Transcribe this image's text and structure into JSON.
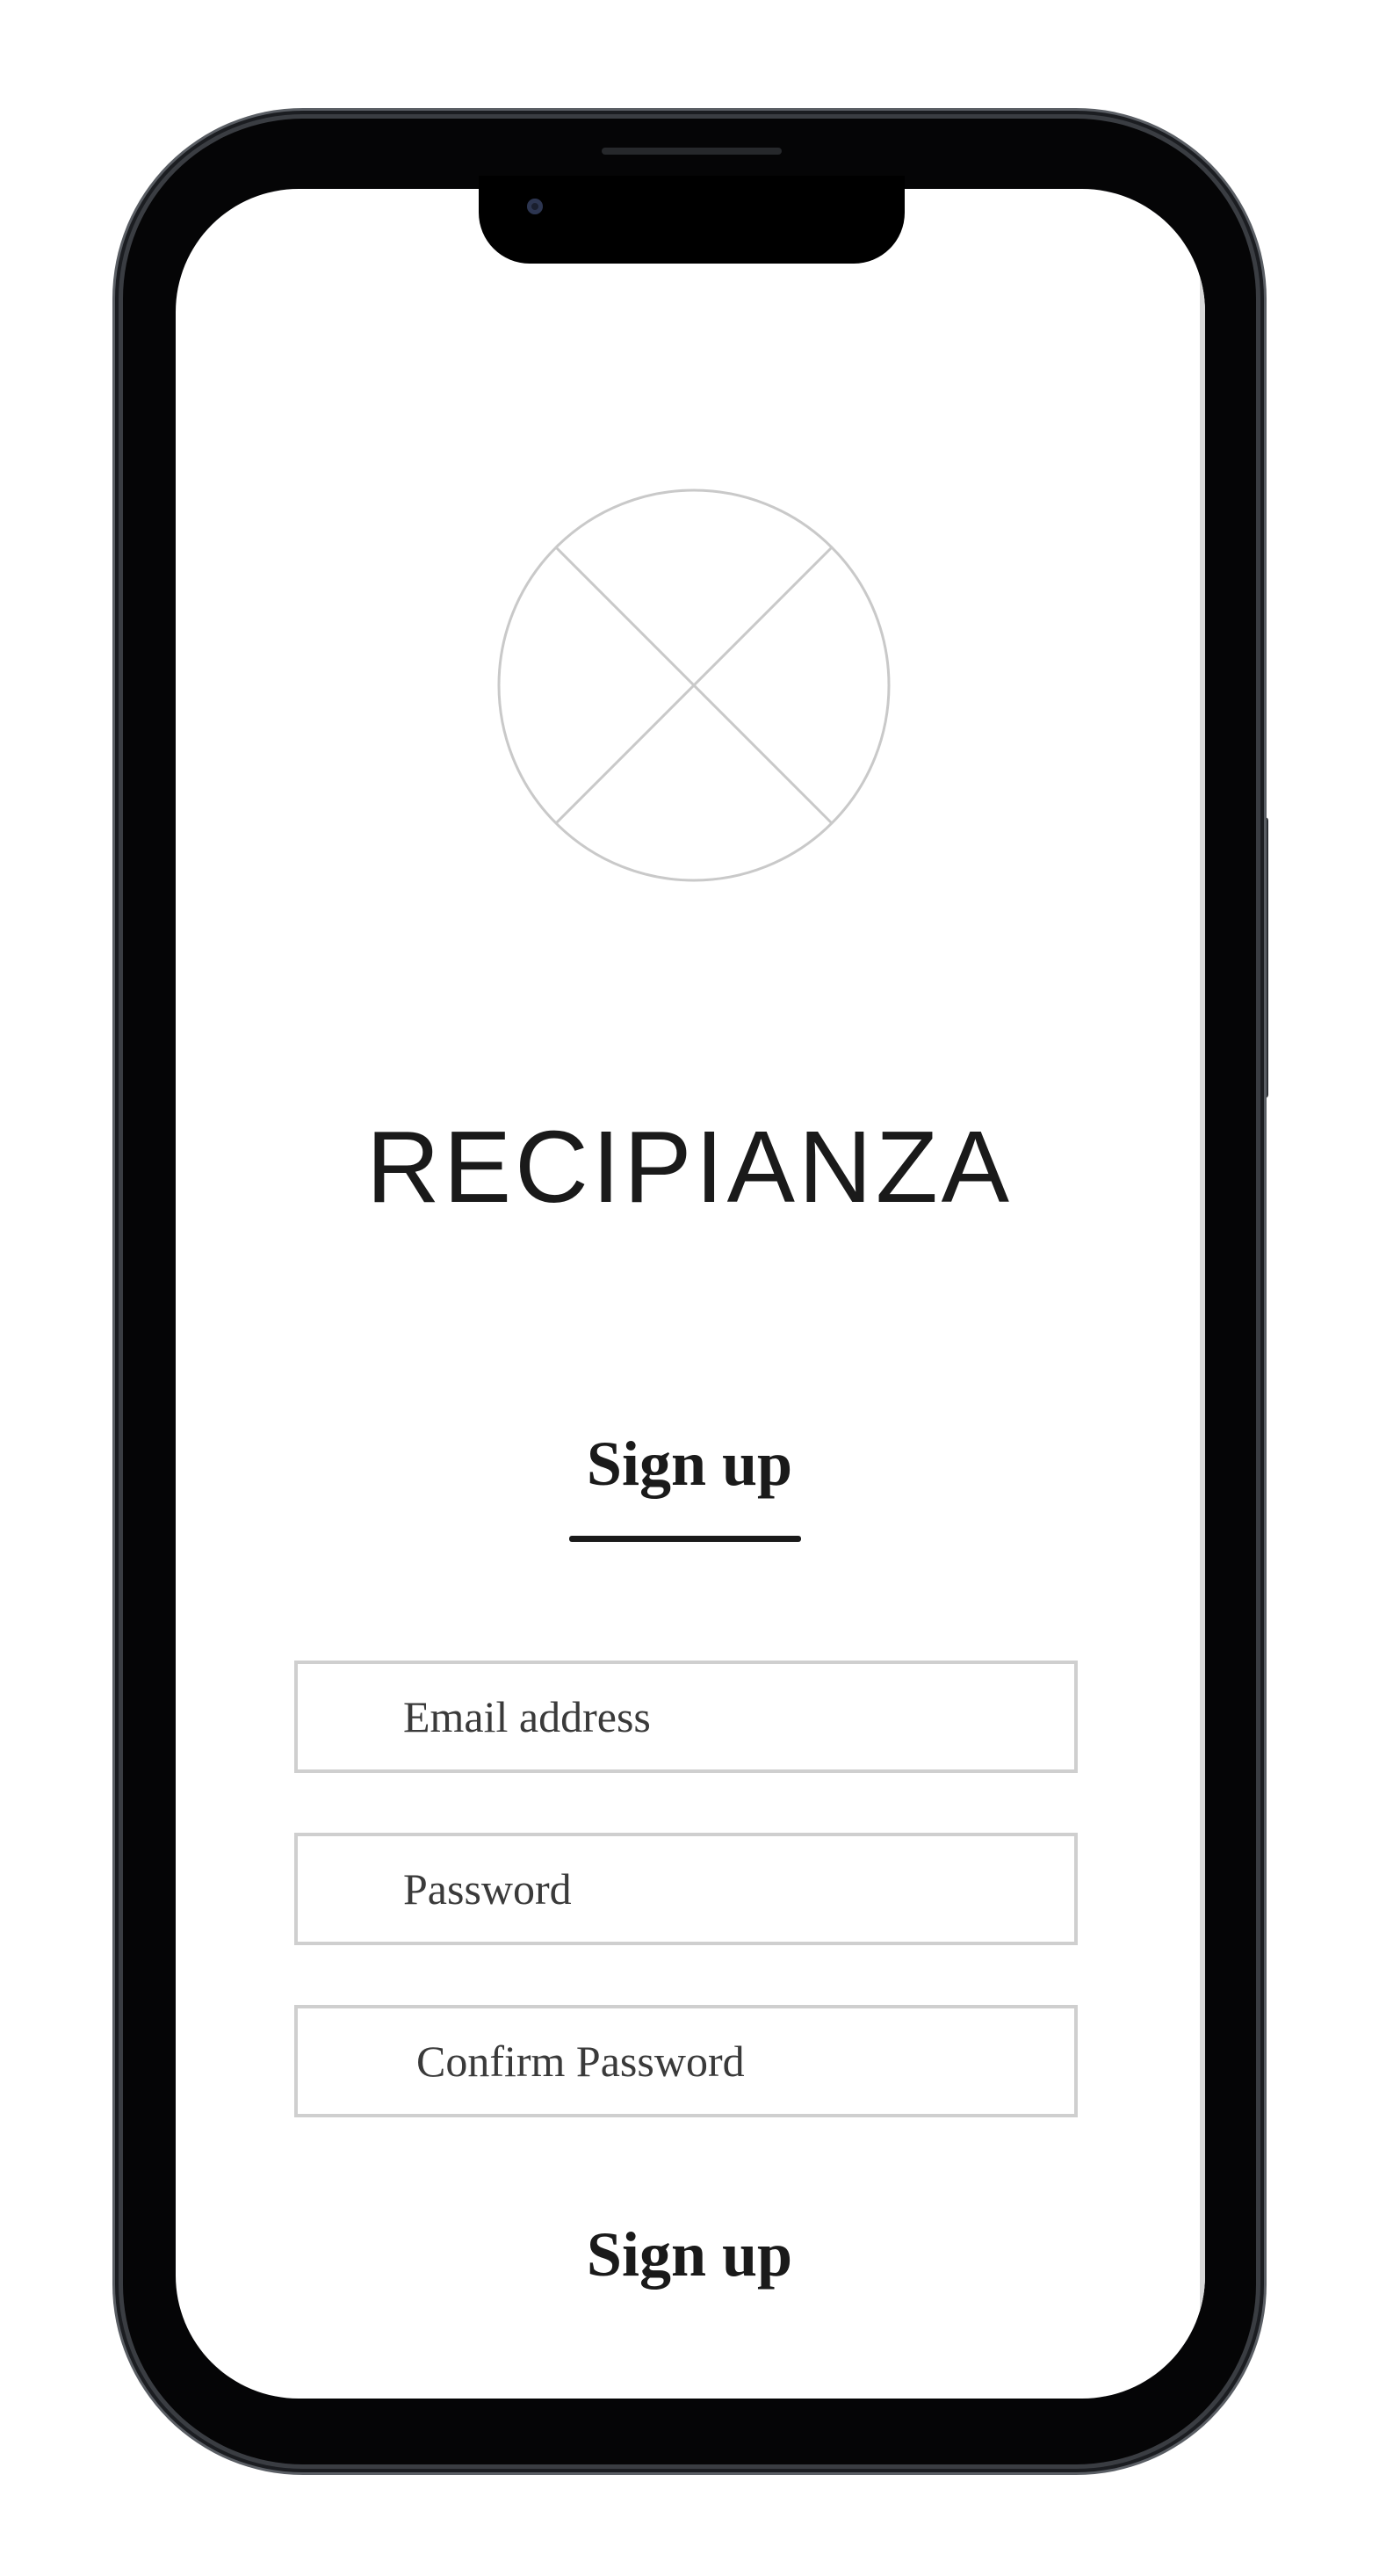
{
  "app": {
    "title": "RECIPIANZA"
  },
  "auth": {
    "tab_label": "Sign up",
    "fields": {
      "email_placeholder": "Email address",
      "password_placeholder": "Password",
      "confirm_password_placeholder": "Confirm Password"
    },
    "submit_label": "Sign up"
  },
  "icons": {
    "logo": "image-placeholder-icon",
    "camera": "front-camera-icon"
  },
  "colors": {
    "text": "#1a1a1a",
    "field_border": "#cfcfcf",
    "frame": "#050506"
  }
}
